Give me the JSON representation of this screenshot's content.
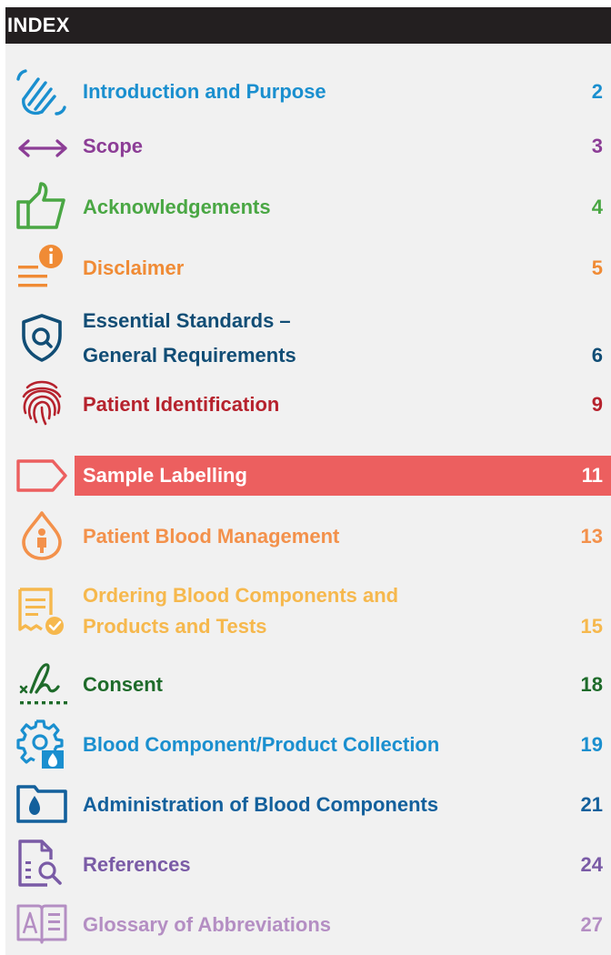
{
  "header": {
    "title": "INDEX"
  },
  "entries": [
    {
      "label": "Introduction and Purpose",
      "page": "2",
      "icon": "hand-wave-icon",
      "color": "#1a8fcf"
    },
    {
      "label": "Scope",
      "page": "3",
      "icon": "double-arrow-icon",
      "color": "#8c3d96"
    },
    {
      "label": "Acknowledgements",
      "page": "4",
      "icon": "thumbs-up-icon",
      "color": "#4aa744"
    },
    {
      "label": "Disclaimer",
      "page": "5",
      "icon": "info-lines-icon",
      "color": "#f08b35"
    },
    {
      "label_line1": "Essential Standards –",
      "label_line2": "General Requirements",
      "page": "6",
      "icon": "shield-search-icon",
      "color": "#114d75"
    },
    {
      "label": "Patient Identification",
      "page": "9",
      "icon": "fingerprint-icon",
      "color": "#b6222d"
    },
    {
      "label": "Sample Labelling",
      "page": "11",
      "icon": "tag-icon",
      "color": "#ffffff",
      "highlight": "#ec5f5f"
    },
    {
      "label": "Patient Blood Management",
      "page": "13",
      "icon": "blood-drop-person-icon",
      "color": "#f3914b"
    },
    {
      "label_line1": "Ordering Blood Components and",
      "label_line2": "Products and Tests",
      "page": "15",
      "icon": "document-check-icon",
      "color": "#f6b84d"
    },
    {
      "label": "Consent",
      "page": "18",
      "icon": "signature-icon",
      "color": "#1e6b2a"
    },
    {
      "label": "Blood Component/Product Collection",
      "page": "19",
      "icon": "gear-drop-icon",
      "color": "#1a8fcf"
    },
    {
      "label": "Administration of Blood Components",
      "page": "21",
      "icon": "folder-drop-icon",
      "color": "#13609c"
    },
    {
      "label": "References",
      "page": "24",
      "icon": "document-search-icon",
      "color": "#7a5ba6"
    },
    {
      "label": "Glossary of Abbreviations",
      "page": "27",
      "icon": "book-icon",
      "color": "#b48ec3"
    }
  ]
}
